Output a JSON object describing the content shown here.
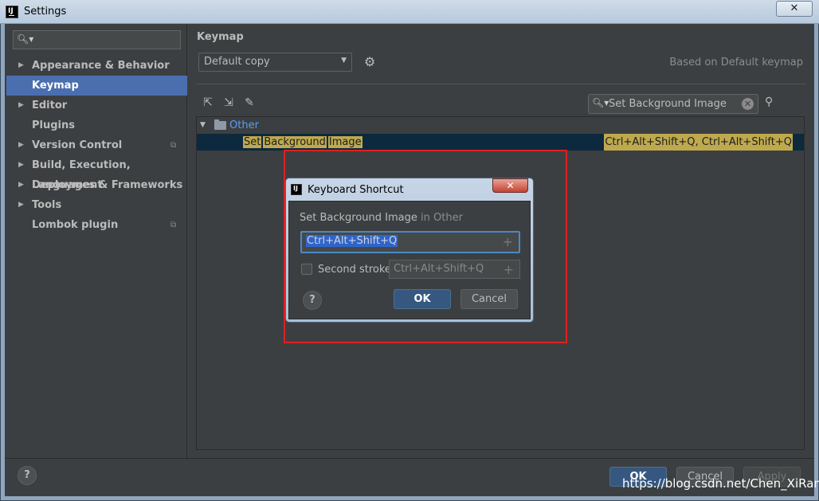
{
  "window": {
    "title": "Settings",
    "close_label": "✕"
  },
  "sidebar": {
    "search_placeholder": "",
    "items": [
      {
        "label": "Appearance & Behavior",
        "expandable": true,
        "project": false
      },
      {
        "label": "Keymap",
        "expandable": false,
        "project": false,
        "selected": true
      },
      {
        "label": "Editor",
        "expandable": true,
        "project": false
      },
      {
        "label": "Plugins",
        "expandable": false,
        "project": false
      },
      {
        "label": "Version Control",
        "expandable": true,
        "project": true
      },
      {
        "label": "Build, Execution, Deployment",
        "expandable": true,
        "project": false
      },
      {
        "label": "Languages & Frameworks",
        "expandable": true,
        "project": false
      },
      {
        "label": "Tools",
        "expandable": true,
        "project": false
      },
      {
        "label": "Lombok plugin",
        "expandable": false,
        "project": true
      }
    ]
  },
  "main": {
    "title": "Keymap",
    "scheme": "Default copy",
    "based_on": "Based on Default keymap",
    "search_value": "Set Background Image",
    "tree": {
      "category": "Other",
      "action_words": [
        "Set",
        "Background",
        "Image"
      ],
      "action_shortcuts": "Ctrl+Alt+Shift+Q, Ctrl+Alt+Shift+Q"
    }
  },
  "dialog": {
    "title": "Keyboard Shortcut",
    "action": "Set Background Image",
    "in_text": "in Other",
    "first_stroke": "Ctrl+Alt+Shift+Q",
    "second_stroke_label": "Second stroke:",
    "second_stroke_value": "Ctrl+Alt+Shift+Q",
    "ok": "OK",
    "cancel": "Cancel",
    "help": "?"
  },
  "footer": {
    "help": "?",
    "ok": "OK",
    "cancel": "Cancel",
    "apply": "Apply"
  },
  "watermark": "https://blog.csdn.net/Chen_XiRan",
  "colors": {
    "selection": "#4b6eaf",
    "highlight": "#bea94e",
    "annotation_box": "#e02020"
  }
}
